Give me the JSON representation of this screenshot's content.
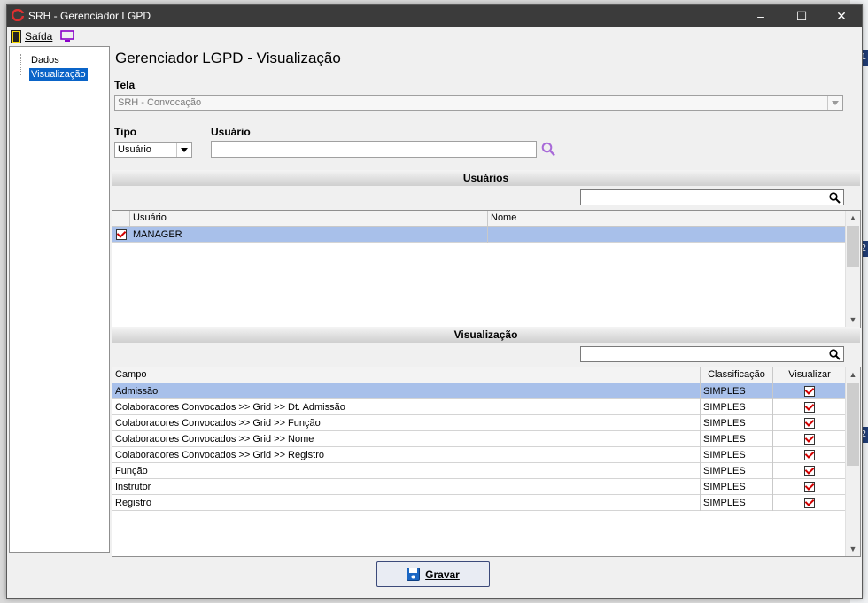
{
  "window": {
    "title": "SRH - Gerenciador LGPD",
    "minimize": "–",
    "maximize": "☐",
    "close": "✕"
  },
  "menu": {
    "exit_label": "Saída"
  },
  "tree": {
    "items": [
      {
        "label": "Dados"
      },
      {
        "label": "Visualização"
      }
    ]
  },
  "page": {
    "title": "Gerenciador LGPD - Visualização"
  },
  "form": {
    "tela_label": "Tela",
    "tela_value": "SRH - Convocação",
    "tipo_label": "Tipo",
    "tipo_value": "Usuário",
    "usuario_label": "Usuário",
    "usuario_value": ""
  },
  "usuarios": {
    "header": "Usuários",
    "search_value": "",
    "columns": [
      "Usuário",
      "Nome"
    ],
    "rows": [
      {
        "checked": true,
        "usuario": "MANAGER",
        "nome": ""
      }
    ]
  },
  "visualizacao": {
    "header": "Visualização",
    "search_value": "",
    "columns": [
      "Campo",
      "Classificação",
      "Visualizar"
    ],
    "rows": [
      {
        "campo": "Admissão",
        "classificacao": "SIMPLES",
        "visualizar": true
      },
      {
        "campo": "Colaboradores Convocados >> Grid >> Dt. Admissão",
        "classificacao": "SIMPLES",
        "visualizar": true
      },
      {
        "campo": "Colaboradores Convocados >> Grid >> Função",
        "classificacao": "SIMPLES",
        "visualizar": true
      },
      {
        "campo": "Colaboradores Convocados >> Grid >> Nome",
        "classificacao": "SIMPLES",
        "visualizar": true
      },
      {
        "campo": "Colaboradores Convocados >> Grid >> Registro",
        "classificacao": "SIMPLES",
        "visualizar": true
      },
      {
        "campo": "Função",
        "classificacao": "SIMPLES",
        "visualizar": true
      },
      {
        "campo": "Instrutor",
        "classificacao": "SIMPLES",
        "visualizar": true
      },
      {
        "campo": "Registro",
        "classificacao": "SIMPLES",
        "visualizar": true
      }
    ]
  },
  "footer": {
    "save_label": "Gravar"
  },
  "background": {
    "marks": [
      "1",
      "2",
      "2"
    ]
  },
  "colors": {
    "selection": "#a8c0ea",
    "titlebar": "#3b3b3b",
    "check": "#d00000"
  }
}
